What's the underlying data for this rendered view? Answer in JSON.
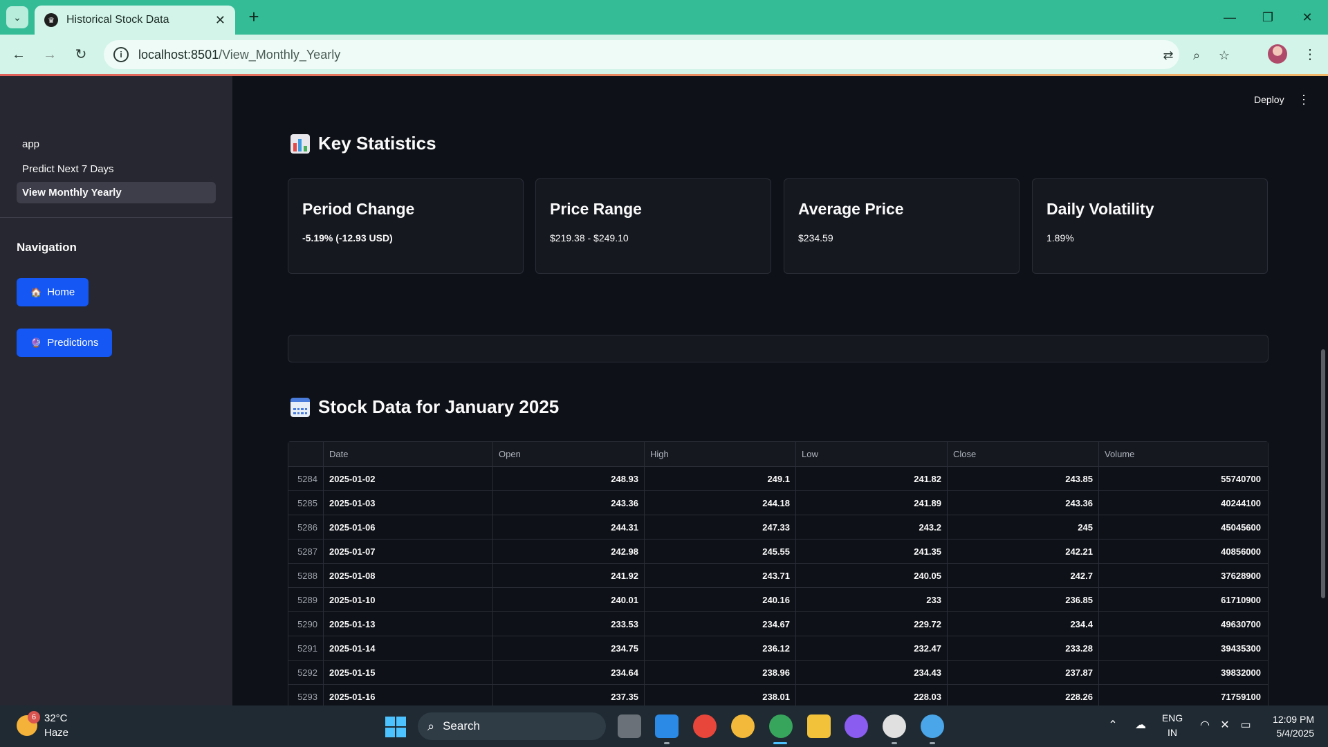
{
  "browser": {
    "tab_title": "Historical Stock Data",
    "url_host": "localhost:8501",
    "url_path": "/View_Monthly_Yearly"
  },
  "sidebar": {
    "pages": [
      "app",
      "Predict Next 7 Days",
      "View Monthly Yearly"
    ],
    "active_page": "View Monthly Yearly",
    "nav_heading": "Navigation",
    "home_label": "Home",
    "predictions_label": "Predictions"
  },
  "header": {
    "deploy_label": "Deploy"
  },
  "key_stats": {
    "title": "Key Statistics",
    "cards": [
      {
        "label": "Period Change",
        "value": "-5.19% (-12.93 USD)"
      },
      {
        "label": "Price Range",
        "value": "$219.38 - $249.10"
      },
      {
        "label": "Average Price",
        "value": "$234.59"
      },
      {
        "label": "Daily Volatility",
        "value": "1.89%"
      }
    ]
  },
  "stock_table": {
    "title": "Stock Data for January 2025",
    "columns": [
      "Date",
      "Open",
      "High",
      "Low",
      "Close",
      "Volume"
    ],
    "rows": [
      [
        "5284",
        "2025-01-02",
        "248.93",
        "249.1",
        "241.82",
        "243.85",
        "55740700"
      ],
      [
        "5285",
        "2025-01-03",
        "243.36",
        "244.18",
        "241.89",
        "243.36",
        "40244100"
      ],
      [
        "5286",
        "2025-01-06",
        "244.31",
        "247.33",
        "243.2",
        "245",
        "45045600"
      ],
      [
        "5287",
        "2025-01-07",
        "242.98",
        "245.55",
        "241.35",
        "242.21",
        "40856000"
      ],
      [
        "5288",
        "2025-01-08",
        "241.92",
        "243.71",
        "240.05",
        "242.7",
        "37628900"
      ],
      [
        "5289",
        "2025-01-10",
        "240.01",
        "240.16",
        "233",
        "236.85",
        "61710900"
      ],
      [
        "5290",
        "2025-01-13",
        "233.53",
        "234.67",
        "229.72",
        "234.4",
        "49630700"
      ],
      [
        "5291",
        "2025-01-14",
        "234.75",
        "236.12",
        "232.47",
        "233.28",
        "39435300"
      ],
      [
        "5292",
        "2025-01-15",
        "234.64",
        "238.96",
        "234.43",
        "237.87",
        "39832000"
      ],
      [
        "5293",
        "2025-01-16",
        "237.35",
        "238.01",
        "228.03",
        "228.26",
        "71759100"
      ]
    ]
  },
  "taskbar": {
    "weather_badge": "6",
    "temperature": "32°C",
    "weather": "Haze",
    "search_label": "Search",
    "lang_1": "ENG",
    "lang_2": "IN",
    "time": "12:09 PM",
    "date": "5/4/2025"
  }
}
